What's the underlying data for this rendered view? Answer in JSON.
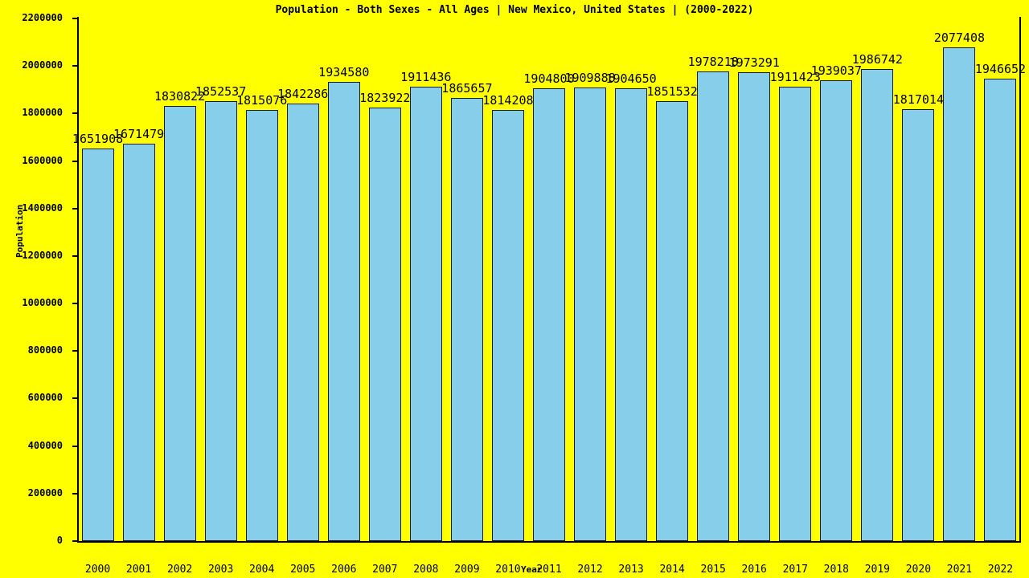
{
  "chart_data": {
    "type": "bar",
    "title": "Population - Both Sexes - All Ages | New Mexico, United States |  (2000-2022)",
    "xlabel": "Year",
    "ylabel": "Population",
    "categories": [
      "2000",
      "2001",
      "2002",
      "2003",
      "2004",
      "2005",
      "2006",
      "2007",
      "2008",
      "2009",
      "2010",
      "2011",
      "2012",
      "2013",
      "2014",
      "2015",
      "2016",
      "2017",
      "2018",
      "2019",
      "2020",
      "2021",
      "2022"
    ],
    "values": [
      1651908,
      1671479,
      1830822,
      1852537,
      1815076,
      1842286,
      1934580,
      1823922,
      1911436,
      1865657,
      1814208,
      1904800,
      1909888,
      1904650,
      1851532,
      1978218,
      1973291,
      1911423,
      1939037,
      1986742,
      1817014,
      2077408,
      1946652
    ],
    "value_labels": [
      "1651908",
      "1671479",
      "1830822",
      "1852537",
      "1815076",
      "1842286",
      "1934580",
      "1823922",
      "1911436",
      "1865657",
      "1814208",
      "1904800",
      "1909888",
      "1904650",
      "1851532",
      "1978218",
      "1973291",
      "1911423",
      "1939037",
      "1986742",
      "1817014",
      "2077408",
      "1946652"
    ],
    "ylim": [
      0,
      2200000
    ],
    "ytick_values": [
      0,
      200000,
      400000,
      600000,
      800000,
      1000000,
      1200000,
      1400000,
      1600000,
      1800000,
      2000000,
      2200000
    ],
    "ytick_labels": [
      "0",
      "200000",
      "400000",
      "600000",
      "800000",
      "1000000",
      "1200000",
      "1400000",
      "1600000",
      "1800000",
      "2000000",
      "2200000"
    ],
    "grid": false,
    "legend": null,
    "bar_color": "#87ceeb",
    "bar_edge_color": "#1a1a2e",
    "background_color": "#ffff00",
    "text_color": "#000000"
  }
}
